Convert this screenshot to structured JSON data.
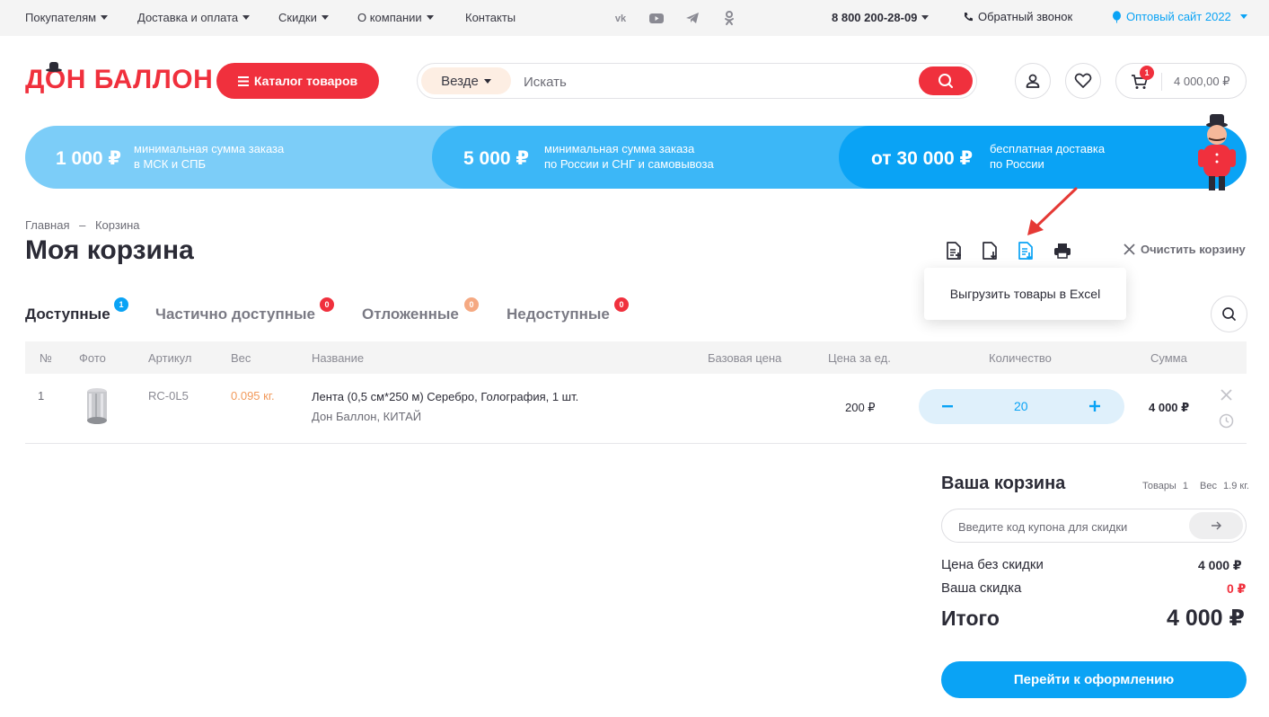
{
  "topbar": {
    "nav": [
      {
        "label": "Покупателям"
      },
      {
        "label": "Доставка и оплата"
      },
      {
        "label": "Скидки"
      },
      {
        "label": "О компании"
      },
      {
        "label": "Контакты"
      }
    ],
    "social_icons": [
      "vk-icon",
      "youtube-icon",
      "telegram-icon",
      "odnoklassniki-icon"
    ],
    "phone": "8 800 200-28-09",
    "callback": "Обратный звонок",
    "wholesale": "Оптовый сайт 2022"
  },
  "header": {
    "logo": "ДОН БАЛЛОН",
    "catalog_label": "Каталог товаров",
    "search_scope": "Везде",
    "search_placeholder": "Искать",
    "cart_count": "1",
    "cart_total": "4 000,00 ₽"
  },
  "banner": {
    "items": [
      {
        "amount": "1 000 ₽",
        "line1": "минимальная сумма заказа",
        "line2": "в МСК и СПБ"
      },
      {
        "amount": "5 000 ₽",
        "line1": "минимальная сумма заказа",
        "line2": "по России и СНГ и самовывоза"
      },
      {
        "amount": "от 30 000 ₽",
        "line1": "бесплатная доставка",
        "line2": "по России"
      }
    ]
  },
  "breadcrumb": {
    "home": "Главная",
    "sep": "–",
    "current": "Корзина"
  },
  "page_title": "Моя корзина",
  "toolbar": {
    "clear_label": "Очистить корзину",
    "tooltip": "Выгрузить товары в Excel"
  },
  "tabs": [
    {
      "label": "Доступные",
      "count": "1"
    },
    {
      "label": "Частично доступные",
      "count": "0"
    },
    {
      "label": "Отложенные",
      "count": "0"
    },
    {
      "label": "Недоступные",
      "count": "0"
    }
  ],
  "table": {
    "headers": [
      "№",
      "Фото",
      "Артикул",
      "Вес",
      "Название",
      "Базовая цена",
      "Цена за ед.",
      "Количество",
      "Сумма"
    ],
    "rows": [
      {
        "num": "1",
        "article": "RC-0L5",
        "weight": "0.095 кг.",
        "name": "Лента (0,5 см*250 м) Серебро, Голография, 1 шт.",
        "brand": "Дон Баллон, КИТАЙ",
        "base_price": "",
        "unit_price": "200 ₽",
        "qty": "20",
        "sum": "4 000 ₽"
      }
    ]
  },
  "summary": {
    "title": "Ваша корзина",
    "items_label": "Товары",
    "items_value": "1",
    "weight_label": "Вес",
    "weight_value": "1.9 кг.",
    "coupon_placeholder": "Введите код купона для скидки",
    "subtotal_label": "Цена без скидки",
    "subtotal_value": "4 000 ₽",
    "discount_label": "Ваша скидка",
    "discount_value": "0 ₽",
    "total_label": "Итого",
    "total_value": "4 000 ₽",
    "checkout_label": "Перейти к оформлению"
  },
  "colors": {
    "brand_red": "#f0303d",
    "accent_blue": "#0aa3f5",
    "weight_orange": "#f29a5c"
  }
}
